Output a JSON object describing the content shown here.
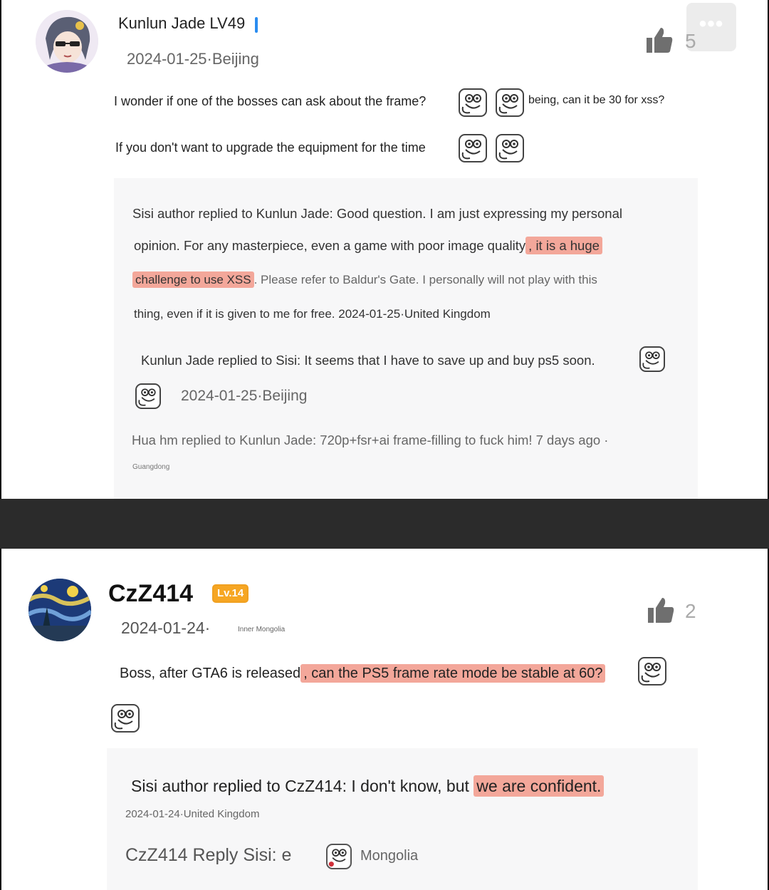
{
  "comment1": {
    "username": "Kunlun Jade LV49",
    "date_location": "2024-01-25·Beijing",
    "more_icon": "more-dots-icon",
    "like_count": "5",
    "line1": "I wonder if one of the bosses can ask about the frame?",
    "line1_tail": "being, can it be 30 for xss?",
    "line2": "If you don't want to upgrade the equipment for the time",
    "replies": {
      "r1_line1": "Sisi author replied to Kunlun Jade: Good question. I am just expressing my personal",
      "r1_line2_a": "opinion. For any masterpiece, even a game with poor image quality",
      "r1_line2_b": ", it is a huge",
      "r1_line3_a": "challenge to use XSS",
      "r1_line3_b": ". Please refer to Baldur's Gate. I personally will not play with this",
      "r1_line4": "thing, even if it is given to me for free. 2024-01-25·United Kingdom",
      "r2_line1": "Kunlun Jade replied to Sisi: It seems that I have to save up and buy ps5 soon.",
      "r2_date": "2024-01-25·Beijing",
      "r3_line1": "Hua hm replied to Kunlun Jade: 720p+fsr+ai frame-filling to fuck him! 7 days ago ·",
      "r3_location": "Guangdong"
    }
  },
  "comment2": {
    "username": "CzZ414",
    "level": "Lv.14",
    "date": "2024-01-24·",
    "location": "Inner Mongolia",
    "like_count": "2",
    "body_a": "Boss, after GTA6 is released",
    "body_b": ", can the PS5 frame rate mode be stable at 60?",
    "replies": {
      "r1_a": "Sisi author replied to CzZ414: I don't know, but ",
      "r1_b": "we are confident.",
      "r1_date": "2024-01-24·United Kingdom",
      "r2_a": "CzZ414 Reply Sisi: e",
      "r2_b": "Mongolia"
    }
  }
}
